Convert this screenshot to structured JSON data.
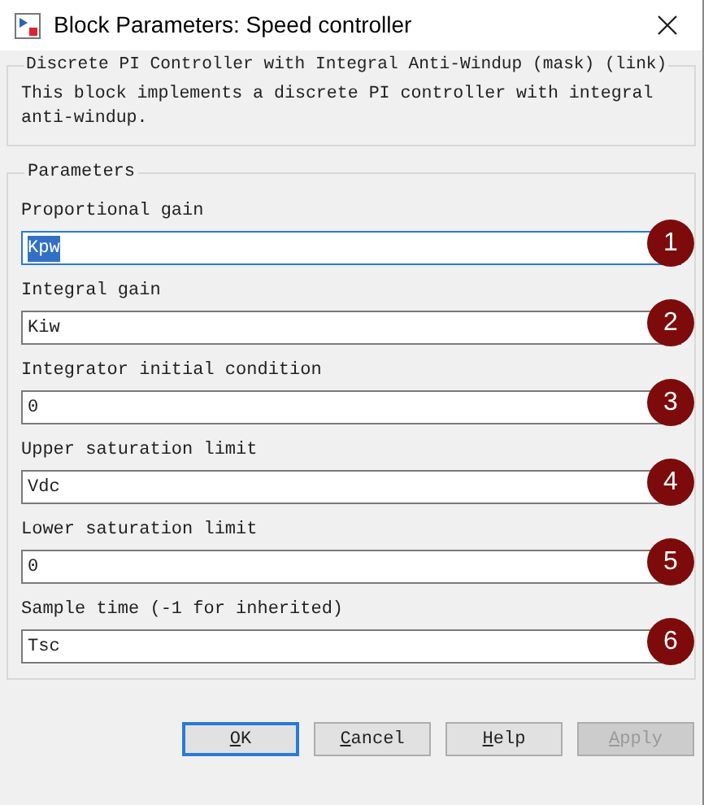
{
  "window": {
    "title": "Block Parameters: Speed controller"
  },
  "description": {
    "title": "Discrete PI Controller with Integral Anti-Windup (mask) (link)",
    "text": "This block implements a discrete PI controller with integral anti-windup."
  },
  "parameters": {
    "title": "Parameters",
    "fields": [
      {
        "label": "Proportional gain",
        "value": "Kpw",
        "focused": true,
        "badge": "1"
      },
      {
        "label": "Integral gain",
        "value": "Kiw",
        "focused": false,
        "badge": "2"
      },
      {
        "label": "Integrator initial condition",
        "value": "0",
        "focused": false,
        "badge": "3"
      },
      {
        "label": "Upper saturation limit",
        "value": "Vdc",
        "focused": false,
        "badge": "4"
      },
      {
        "label": "Lower saturation limit",
        "value": "0",
        "focused": false,
        "badge": "5"
      },
      {
        "label": "Sample time (-1 for inherited)",
        "value": "Tsc",
        "focused": false,
        "badge": "6"
      }
    ]
  },
  "buttons": [
    {
      "label": "OK",
      "default": true,
      "disabled": false
    },
    {
      "label": "Cancel",
      "default": false,
      "disabled": false
    },
    {
      "label": "Help",
      "default": false,
      "disabled": false
    },
    {
      "label": "Apply",
      "default": false,
      "disabled": true
    }
  ]
}
